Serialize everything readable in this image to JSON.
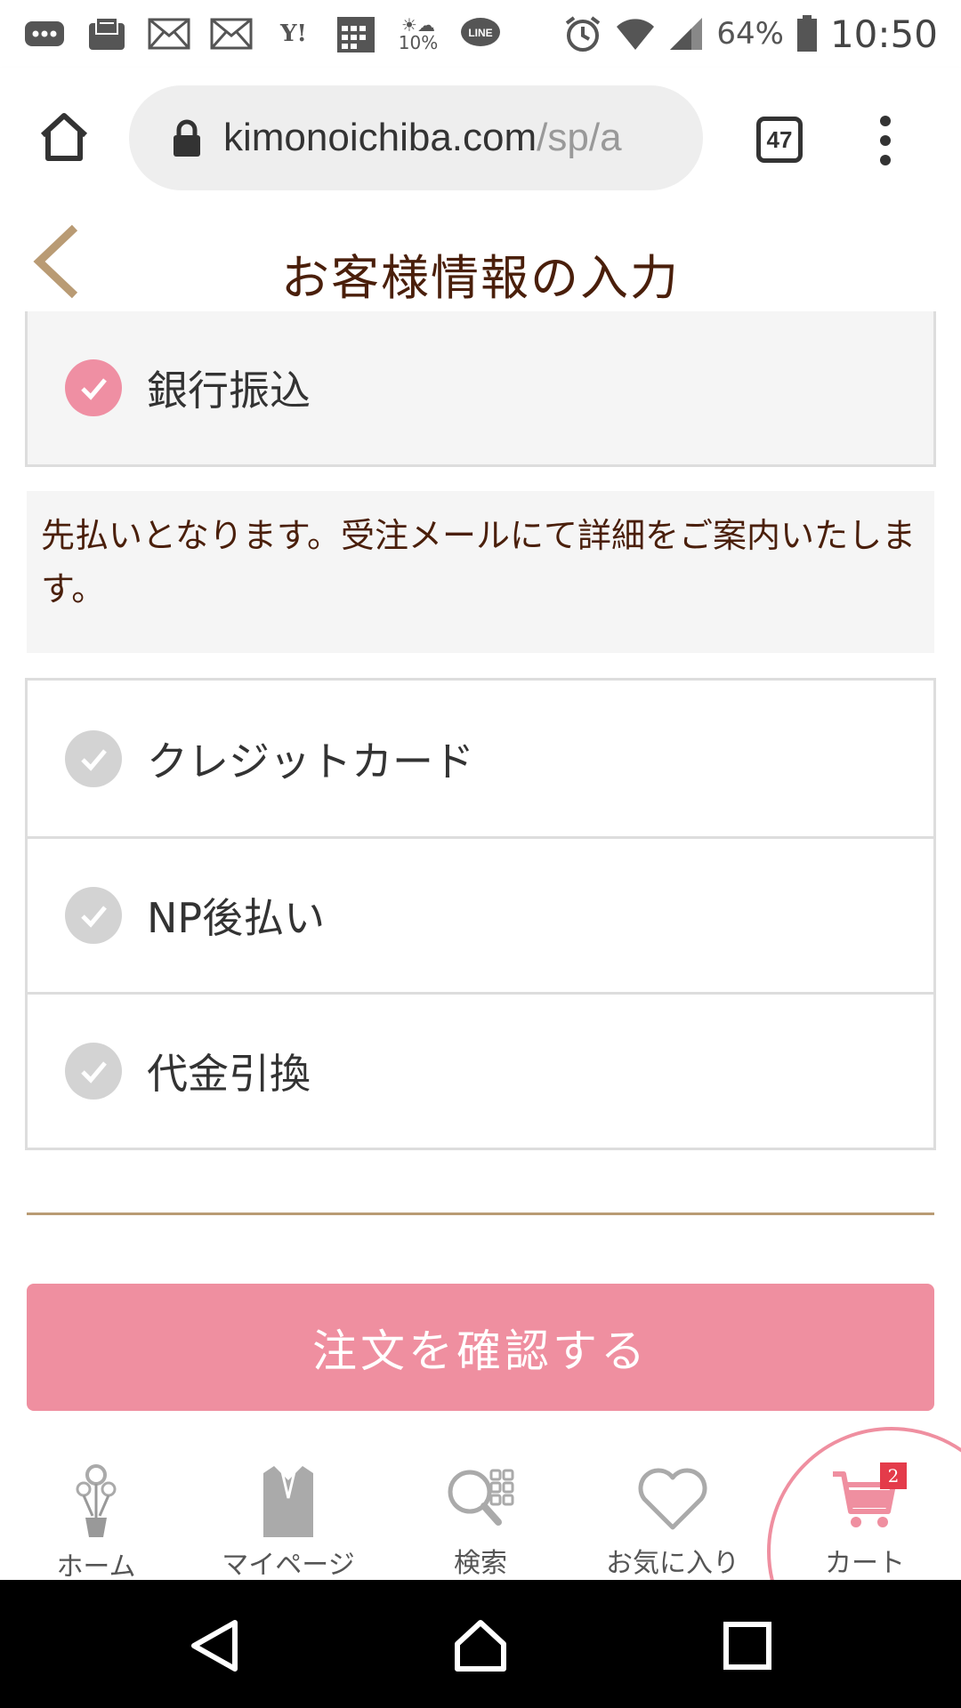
{
  "status_bar": {
    "notification_icons": [
      "chat-bubble-icon",
      "mail-icon",
      "yahoo-mail-icon",
      "yahoo-mail-icon",
      "yahoo-icon",
      "calendar-icon",
      "weather-icon",
      "line-icon"
    ],
    "weather_percent": "10%",
    "battery": "64%",
    "time": "10:50"
  },
  "browser": {
    "url_host": "kimonoichiba.com",
    "url_path": "/sp/a",
    "tab_count": "47"
  },
  "header": {
    "title": "お客様情報の入力"
  },
  "payment": {
    "selected": {
      "label": "銀行振込",
      "note": "先払いとなります。受注メールにて詳細をご案内いたします。"
    },
    "options": [
      {
        "label": "クレジットカード"
      },
      {
        "label": "NP後払い"
      },
      {
        "label": "代金引換"
      }
    ]
  },
  "confirm_button": "注文を確認する",
  "bottom_nav": {
    "home": "ホーム",
    "mypage": "マイページ",
    "search": "検索",
    "favorites": "お気に入り",
    "cart": "カート",
    "cart_badge": "2"
  },
  "colors": {
    "accent_pink": "#ef8fa0",
    "title_brown": "#4a1f0b",
    "divider_gold": "#b99b74"
  }
}
